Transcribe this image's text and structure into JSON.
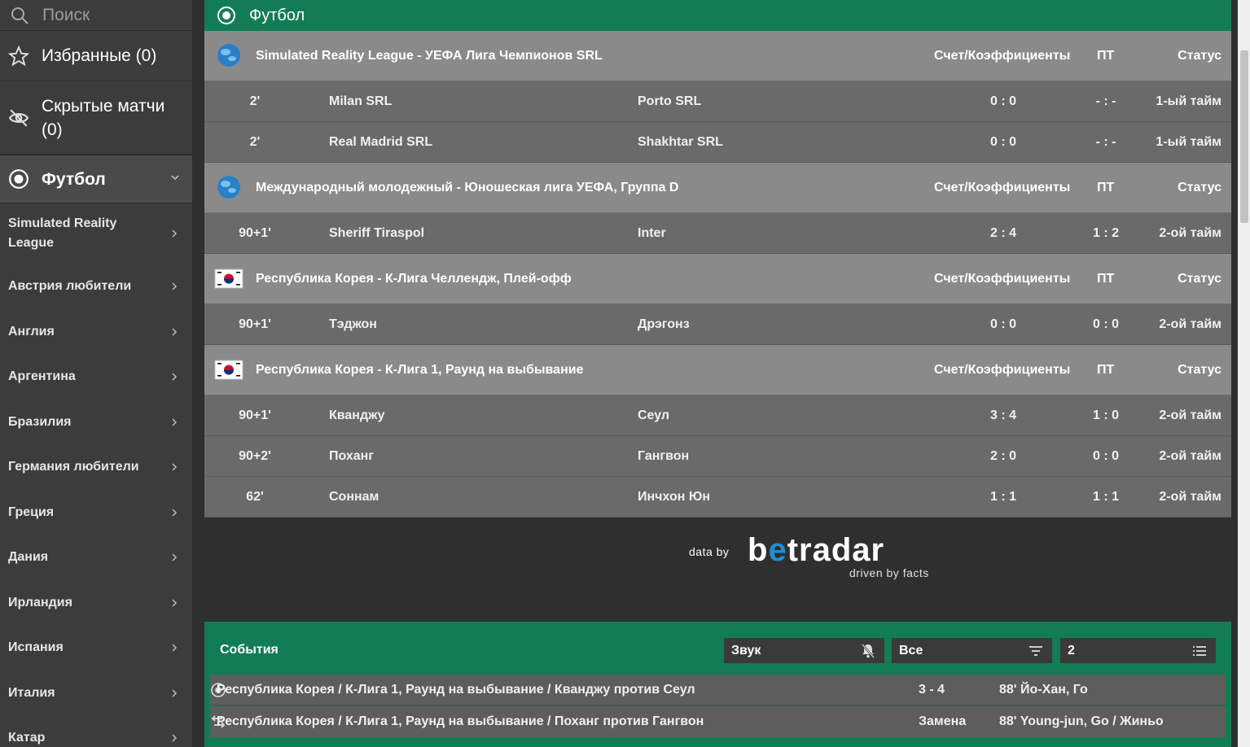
{
  "sidebar": {
    "search_placeholder": "Поиск",
    "favorites_label": "Избранные (0)",
    "hidden_label": "Скрытые матчи (0)",
    "sport_label": "Футбол",
    "countries": [
      "Simulated Reality League",
      "Австрия любители",
      "Англия",
      "Аргентина",
      "Бразилия",
      "Германия любители",
      "Греция",
      "Дания",
      "Ирландия",
      "Испания",
      "Италия",
      "Катар"
    ]
  },
  "main": {
    "header_title": "Футбол",
    "col_score": "Счет/Коэффициенты",
    "col_ht": "ПТ",
    "col_status": "Статус",
    "leagues": [
      {
        "name": "Simulated Reality League - УЕФА Лига Чемпионов SRL",
        "flag": "globe-icon",
        "matches": [
          {
            "time": "2'",
            "home": "Milan SRL",
            "away": "Porto SRL",
            "score": "0 : 0",
            "ht": "- : -",
            "status": "1-ый тайм"
          },
          {
            "time": "2'",
            "home": "Real Madrid SRL",
            "away": "Shakhtar SRL",
            "score": "0 : 0",
            "ht": "- : -",
            "status": "1-ый тайм"
          }
        ]
      },
      {
        "name": "Международный молодежный - Юношеская лига УЕФА, Группа D",
        "flag": "globe-icon",
        "matches": [
          {
            "time": "90+1'",
            "home": "Sheriff Tiraspol",
            "away": "Inter",
            "score": "2 : 4",
            "ht": "1 : 2",
            "status": "2-ой тайм"
          }
        ]
      },
      {
        "name": "Республика Корея - К-Лига Челлендж, Плей-офф",
        "flag": "korea-flag-icon",
        "matches": [
          {
            "time": "90+1'",
            "home": "Тэджон",
            "away": "Дрэгонз",
            "score": "0 : 0",
            "ht": "0 : 0",
            "status": "2-ой тайм"
          }
        ]
      },
      {
        "name": "Республика Корея - К-Лига 1, Раунд на выбывание",
        "flag": "korea-flag-icon",
        "matches": [
          {
            "time": "90+1'",
            "home": "Кванджу",
            "away": "Сеул",
            "score": "3 : 4",
            "ht": "1 : 0",
            "status": "2-ой тайм"
          },
          {
            "time": "90+2'",
            "home": "Поханг",
            "away": "Гангвон",
            "score": "2 : 0",
            "ht": "0 : 0",
            "status": "2-ой тайм"
          },
          {
            "time": "62'",
            "home": "Соннам",
            "away": "Инчхон Юн",
            "score": "1 : 1",
            "ht": "1 : 1",
            "status": "2-ой тайм"
          }
        ]
      }
    ]
  },
  "branding": {
    "data_by": "data by",
    "brand_pre": "b",
    "brand_o": "e",
    "brand_post": "tradar",
    "tagline": "driven by facts"
  },
  "events": {
    "title": "События",
    "sound_label": "Звук",
    "filter_label": "Все",
    "count_value": "2",
    "rows": [
      {
        "desc": "Республика Корея / К-Лига 1, Раунд на выбывание / Кванджу против Сеул",
        "icon": "ball-icon",
        "value": "3 - 4",
        "info": "88' Йо-Хан, Го"
      },
      {
        "desc": "Республика Корея / К-Лига 1, Раунд на выбывание / Поханг против Гангвон",
        "icon": "substitution-icon",
        "value": "Замена",
        "info": "88' Young-jun, Go / Жиньо"
      }
    ]
  },
  "colors": {
    "accent_green": "#127c55",
    "league_row": "#8a8a8a",
    "match_row": "#6a6a6a",
    "sidebar_bg": "#3c3c3c",
    "brand_blue": "#1c8fd8"
  }
}
